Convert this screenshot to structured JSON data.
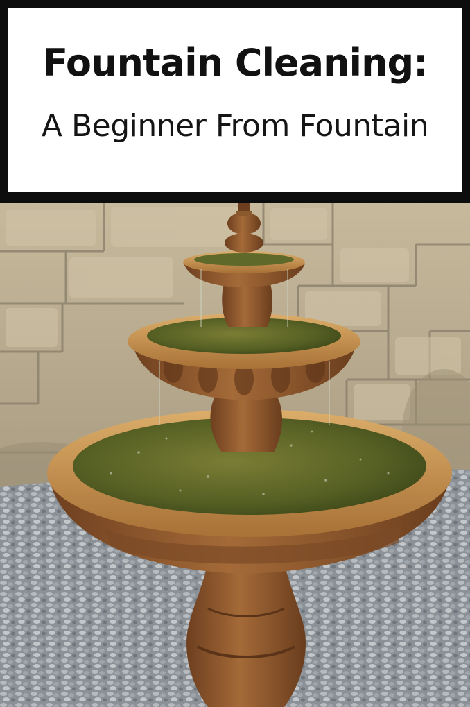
{
  "title": {
    "main": "Fountain Cleaning:",
    "subtitle": "A Beginner From Fountain"
  },
  "photo": {
    "subject": "fountain-photo",
    "colors": {
      "wall": "#b9ab90",
      "mortar": "#8c8270",
      "gravel": "#9aa0a4",
      "stone": "#a6784a",
      "stone_dark": "#7a4a26",
      "rim": "#c99a5c",
      "water": "#5f6a2a",
      "water_light": "#8a8d3c"
    }
  }
}
